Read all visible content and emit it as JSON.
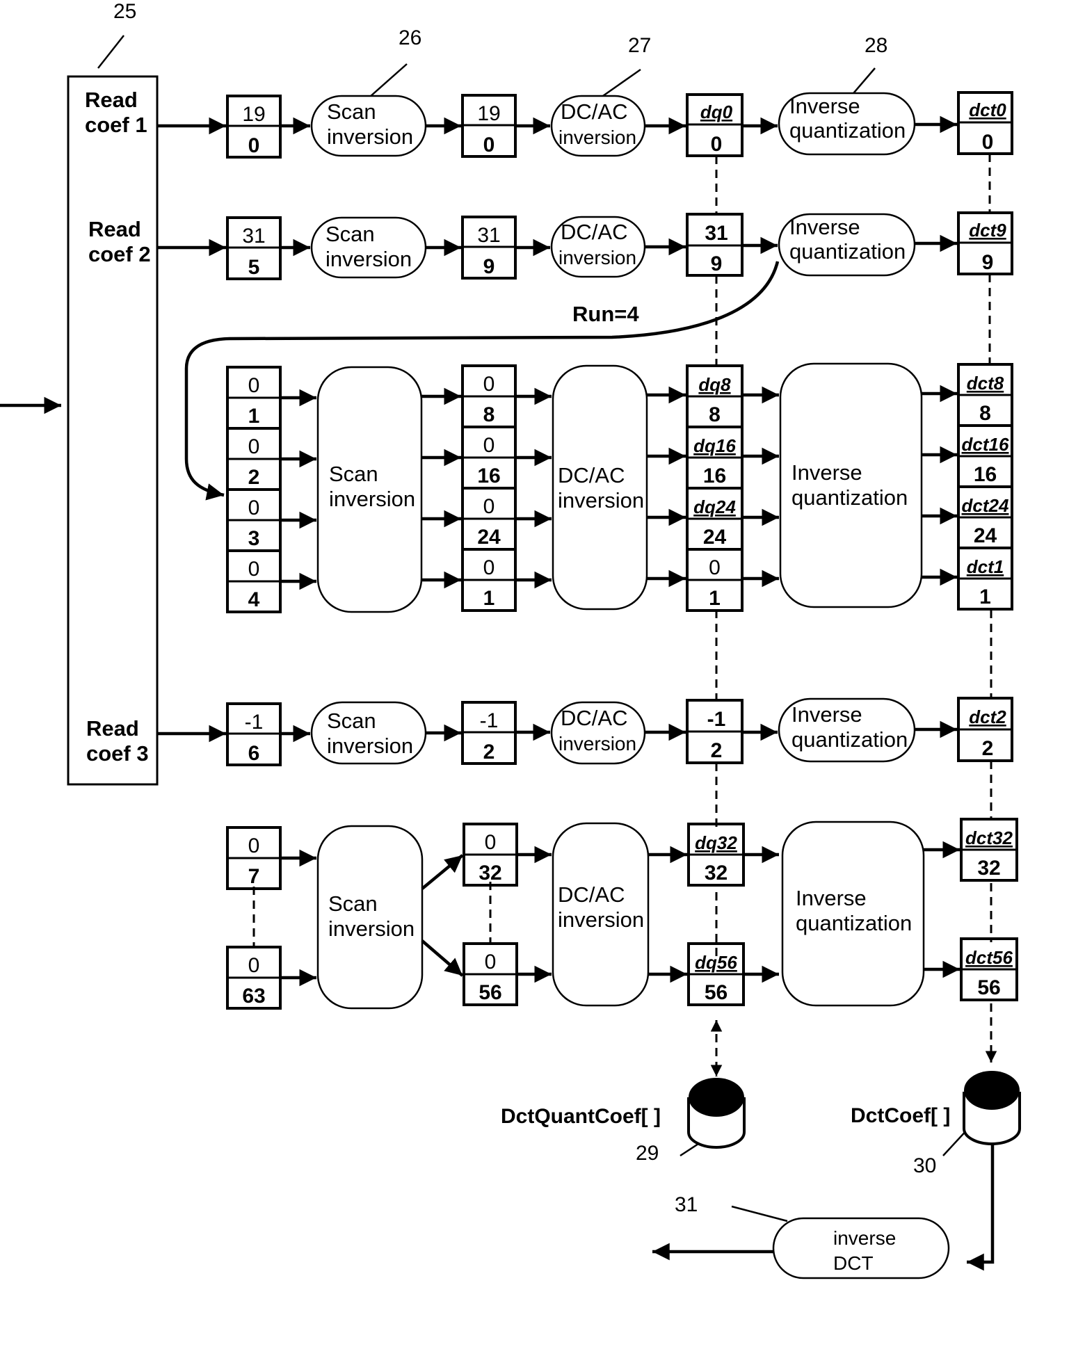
{
  "ref_labels": {
    "read_block": "25",
    "scan_inversion": "26",
    "dcac_inversion": "27",
    "inverse_quantization": "28",
    "dct_quant_coef_store": "29",
    "dct_coef_store": "30",
    "inverse_dct": "31"
  },
  "read_block": {
    "items": [
      {
        "line1": "Read",
        "line2": "coef 1"
      },
      {
        "line1": "Read",
        "line2": "coef 2"
      },
      {
        "line1": "Read",
        "line2": "coef 3"
      }
    ]
  },
  "process_labels": {
    "scan": {
      "line1": "Scan",
      "line2": "inversion"
    },
    "dcac": {
      "line1": "DC/AC",
      "line2": "inversion"
    },
    "iq": {
      "line1": "Inverse",
      "line2": "quantization"
    },
    "idct": {
      "line1": "inverse",
      "line2": "DCT"
    }
  },
  "run_label": "Run=4",
  "rows": {
    "row1": {
      "input": [
        "19",
        "0"
      ],
      "scanned": [
        "19",
        "0"
      ],
      "dq": [
        "dq0",
        "0"
      ],
      "dct": [
        "dct0",
        "0"
      ]
    },
    "row2": {
      "input": [
        "31",
        "5"
      ],
      "scanned": [
        "31",
        "9"
      ],
      "dq": [
        "31",
        "9"
      ],
      "dct": [
        "dct9",
        "9"
      ]
    },
    "row3": {
      "input": [
        [
          "0",
          "1"
        ],
        [
          "0",
          "2"
        ],
        [
          "0",
          "3"
        ],
        [
          "0",
          "4"
        ]
      ],
      "scanned": [
        [
          "0",
          "8"
        ],
        [
          "0",
          "16"
        ],
        [
          "0",
          "24"
        ],
        [
          "0",
          "1"
        ]
      ],
      "dq": [
        [
          "dq8",
          "8"
        ],
        [
          "dq16",
          "16"
        ],
        [
          "dq24",
          "24"
        ],
        [
          "0",
          "1"
        ]
      ],
      "dct": [
        [
          "dct8",
          "8"
        ],
        [
          "dct16",
          "16"
        ],
        [
          "dct24",
          "24"
        ],
        [
          "dct1",
          "1"
        ]
      ]
    },
    "row4": {
      "input": [
        "-1",
        "6"
      ],
      "scanned": [
        "-1",
        "2"
      ],
      "dq": [
        "-1",
        "2"
      ],
      "dct": [
        "dct2",
        "2"
      ]
    },
    "row5": {
      "input": [
        [
          "0",
          "7"
        ],
        [
          "0",
          "63"
        ]
      ],
      "scanned": [
        [
          "0",
          "32"
        ],
        [
          "0",
          "56"
        ]
      ],
      "dq": [
        [
          "dq32",
          "32"
        ],
        [
          "dq56",
          "56"
        ]
      ],
      "dct": [
        [
          "dct32",
          "32"
        ],
        [
          "dct56",
          "56"
        ]
      ]
    }
  },
  "stores": {
    "quant": "DctQuantCoef[ ]",
    "coef": "DctCoef[ ]"
  },
  "colors": {
    "ink": "#000000",
    "paper": "#ffffff"
  }
}
